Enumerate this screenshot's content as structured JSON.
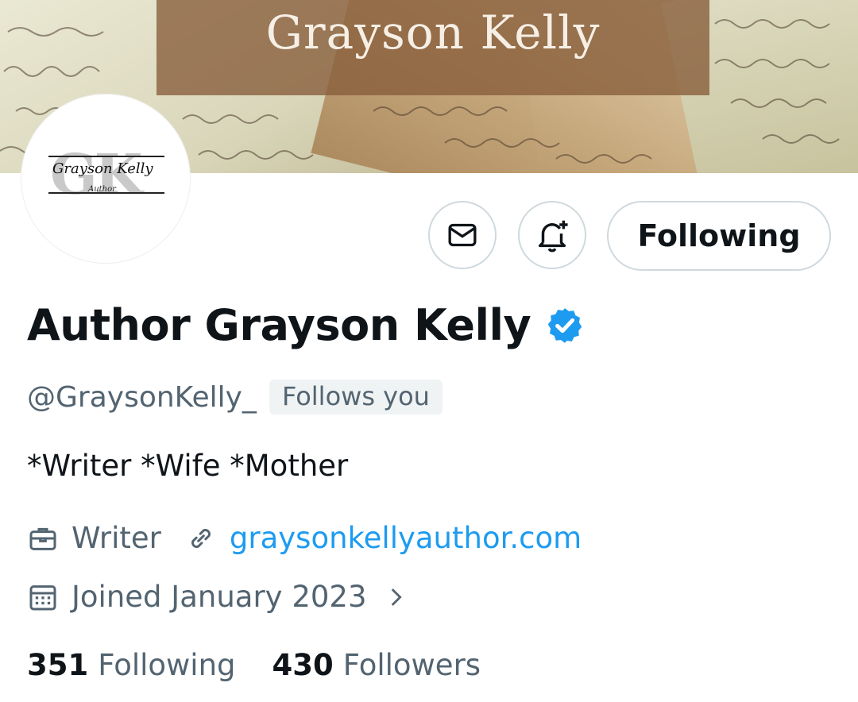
{
  "banner": {
    "title": "Grayson Kelly"
  },
  "avatar": {
    "monogram": "GK",
    "name": "Grayson Kelly",
    "subtitle": "Author"
  },
  "actions": {
    "follow_label": "Following"
  },
  "profile": {
    "display_name": "Author Grayson Kelly",
    "handle": "@GraysonKelly_",
    "follows_you": "Follows you",
    "bio": "*Writer *Wife *Mother",
    "profession": "Writer",
    "website": "graysonkellyauthor.com",
    "joined": "Joined January 2023"
  },
  "stats": {
    "following_count": "351",
    "following_label": "Following",
    "followers_count": "430",
    "followers_label": "Followers"
  },
  "colors": {
    "accent": "#1d9bf0",
    "muted": "#536471",
    "text": "#0f1419"
  },
  "icons": [
    "envelope-icon",
    "bell-plus-icon",
    "verified-badge-icon",
    "briefcase-icon",
    "link-icon",
    "calendar-icon",
    "chevron-right-icon"
  ]
}
